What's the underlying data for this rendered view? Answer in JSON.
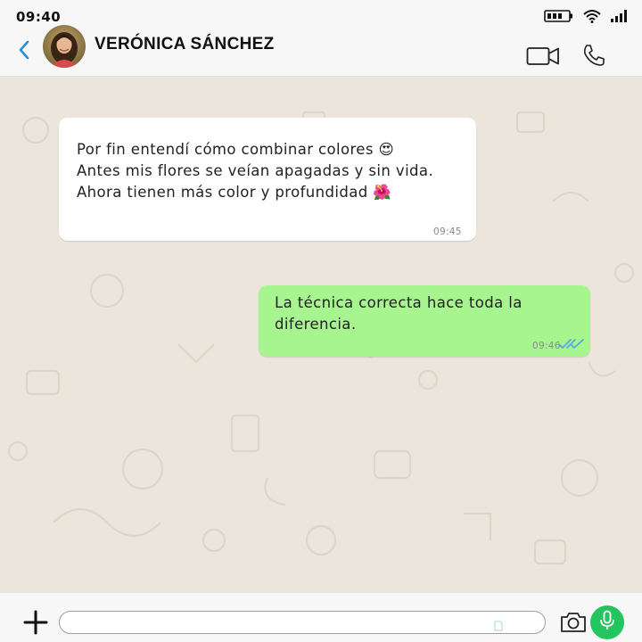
{
  "status_bar": {
    "time": "09:40"
  },
  "header": {
    "contact_name": "VERÓNICA SÁNCHEZ"
  },
  "messages": {
    "incoming": {
      "lines": [
        "Por fin entendí cómo combinar colores 😍",
        "Antes mis flores se veían apagadas y sin vida.",
        "Ahora tienen más color y profundidad 🌺"
      ],
      "time": "09:45"
    },
    "outgoing": {
      "lines": [
        "La técnica correcta hace toda la",
        "diferencia."
      ],
      "time": "09:46",
      "status": "read"
    }
  },
  "input": {
    "value": "",
    "placeholder": ""
  },
  "colors": {
    "outgoing_bubble": "#a6f58f",
    "incoming_bubble": "#ffffff",
    "chat_background": "#ece5dc",
    "accent_blue": "#2d8fd8",
    "mic_green": "#22c55e",
    "read_ticks": "#5aa9dd"
  },
  "icons": {
    "back": "chevron-left-icon",
    "video": "video-camera-icon",
    "call": "phone-icon",
    "battery": "battery-icon",
    "wifi": "wifi-icon",
    "signal": "signal-icon",
    "attach": "plus-icon",
    "sticker": "sticker-icon",
    "camera": "camera-icon",
    "mic": "microphone-icon"
  }
}
